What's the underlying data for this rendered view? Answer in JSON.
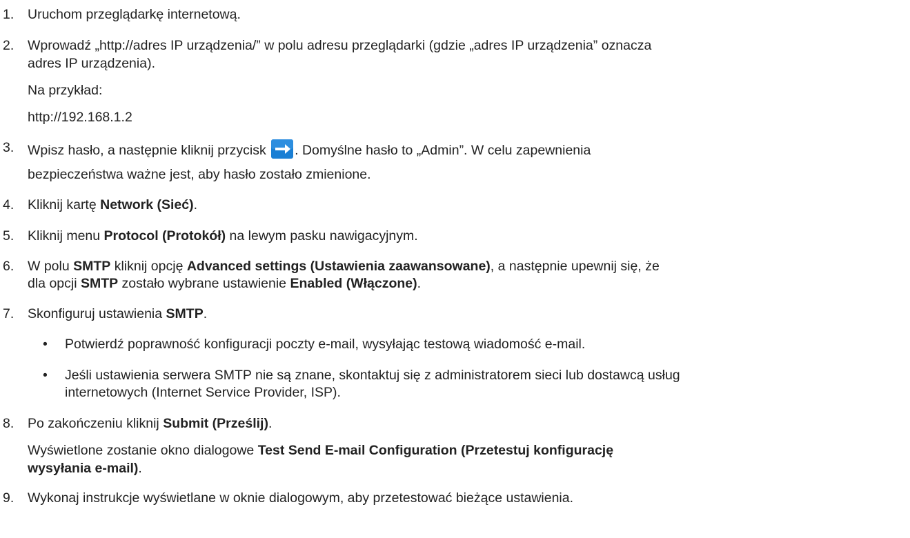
{
  "steps": [
    {
      "num": "1.",
      "text": "Uruchom przeglądarkę internetową."
    },
    {
      "num": "2.",
      "line1": "Wprowadź „http://adres IP urządzenia/” w polu adresu przeglądarki (gdzie „adres IP urządzenia” oznacza",
      "line2": "adres IP urządzenia).",
      "example_label": "Na przykład:",
      "example_url": "http://192.168.1.2"
    },
    {
      "num": "3.",
      "line1_a": "Wpisz hasło, a następnie kliknij przycisk",
      "line1_b": ". Domyślne hasło to „Admin”. W celu zapewnienia",
      "line2": "bezpieczeństwa ważne jest, aby hasło zostało zmienione.",
      "button_icon": "arrow-right-icon",
      "button_color": "#1a7fd4"
    },
    {
      "num": "4.",
      "a": "Kliknij kartę ",
      "b": "Network (Sieć)",
      "c": "."
    },
    {
      "num": "5.",
      "a": "Kliknij menu ",
      "b": "Protocol (Protokół)",
      "c": " na lewym pasku nawigacyjnym."
    },
    {
      "num": "6.",
      "l1a": "W polu ",
      "l1b": "SMTP",
      "l1c": " kliknij opcję ",
      "l1d": "Advanced settings (Ustawienia zaawansowane)",
      "l1e": ", a następnie upewnij się, że",
      "l2a": "dla opcji ",
      "l2b": "SMTP",
      "l2c": " zostało wybrane ustawienie ",
      "l2d": "Enabled (Włączone)",
      "l2e": "."
    },
    {
      "num": "7.",
      "a": "Skonfiguruj ustawienia ",
      "b": "SMTP",
      "c": ".",
      "bullets": [
        {
          "mark": "•",
          "line1": "Potwierdź poprawność konfiguracji poczty e-mail, wysyłając testową wiadomość e-mail."
        },
        {
          "mark": "•",
          "line1": "Jeśli ustawienia serwera SMTP nie są znane, skontaktuj się z administratorem sieci lub dostawcą usług",
          "line2": "internetowych (Internet Service Provider, ISP)."
        }
      ]
    },
    {
      "num": "8.",
      "a": "Po zakończeniu kliknij ",
      "b": "Submit (Prześlij)",
      "c": ".",
      "p_a": "Wyświetlone zostanie okno dialogowe ",
      "p_b": "Test Send E-mail Configuration (Przetestuj konfigurację",
      "p_b2": "wysyłania e-mail)",
      "p_c": "."
    },
    {
      "num": "9.",
      "text": "Wykonaj instrukcje wyświetlane w oknie dialogowym, aby przetestować bieżące ustawienia."
    }
  ]
}
